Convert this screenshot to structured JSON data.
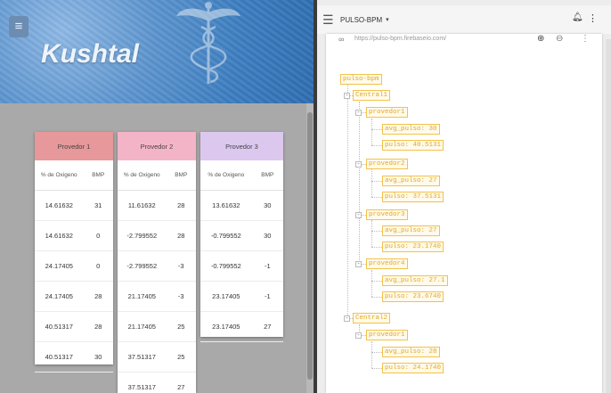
{
  "app": {
    "menu_icon": "hamburger-icon",
    "brand": "Kushtal",
    "emblem_icon": "caduceus-icon"
  },
  "providers": [
    {
      "name": "Provedor 1",
      "color": "#e7989a",
      "col_oxygen": "% de Oxigeno",
      "col_bpm": "BMP",
      "rows": [
        {
          "oxygen": "14.61632",
          "bpm": "31"
        },
        {
          "oxygen": "14.61632",
          "bpm": "0"
        },
        {
          "oxygen": "24.17405",
          "bpm": "0"
        },
        {
          "oxygen": "24.17405",
          "bpm": "28"
        },
        {
          "oxygen": "40.51317",
          "bpm": "28"
        },
        {
          "oxygen": "40.51317",
          "bpm": "30"
        }
      ]
    },
    {
      "name": "Provedor 2",
      "color": "#f4b4c7",
      "col_oxygen": "% de Oxigeno",
      "col_bpm": "BMP",
      "rows": [
        {
          "oxygen": "11.61632",
          "bpm": "28"
        },
        {
          "oxygen": "-2.799552",
          "bpm": "28"
        },
        {
          "oxygen": "-2.799552",
          "bpm": "-3"
        },
        {
          "oxygen": "21.17405",
          "bpm": "-3"
        },
        {
          "oxygen": "21.17405",
          "bpm": "25"
        },
        {
          "oxygen": "37.51317",
          "bpm": "25"
        },
        {
          "oxygen": "37.51317",
          "bpm": "27"
        }
      ]
    },
    {
      "name": "Provedor 3",
      "color": "#dcc7ef",
      "col_oxygen": "% de Oxigeno",
      "col_bpm": "BMP",
      "rows": [
        {
          "oxygen": "13.61632",
          "bpm": "30"
        },
        {
          "oxygen": "-0.799552",
          "bpm": "30"
        },
        {
          "oxygen": "-0.799552",
          "bpm": "-1"
        },
        {
          "oxygen": "23.17405",
          "bpm": "-1"
        },
        {
          "oxygen": "23.17405",
          "bpm": "27"
        }
      ]
    }
  ],
  "firebase": {
    "menu_icon": "hamburger-icon",
    "project": "PULSO-BPM",
    "caret": "▾",
    "bell_icon": "bell-icon",
    "more_icon": "more-vert-icon",
    "url": "https://pulso-bpm.firebaseio.com/",
    "link_icon": "link-icon",
    "add_icon": "add-circle-icon",
    "remove_icon": "remove-circle-icon",
    "tree": {
      "root": "pulso-bpm",
      "central1": "Central1",
      "central2": "Central2",
      "p1": "provedor1",
      "p1_avg": "avg_pulso: 30",
      "p1_pulso": "pulso: 40.5131",
      "p2": "provedor2",
      "p2_avg": "avg_pulso: 27",
      "p2_pulso": "pulso: 37.5131",
      "p3": "provedor3",
      "p3_avg": "avg_pulso: 27",
      "p3_pulso": "pulso: 23.1740",
      "p4": "provedor4",
      "p4_avg": "avg_pulso: 27.1",
      "p4_pulso": "pulso: 23.6740",
      "c2p1": "provedor1",
      "c2p1_avg": "avg_pulso: 28",
      "c2p1_pulso": "pulso: 24.1740"
    }
  }
}
